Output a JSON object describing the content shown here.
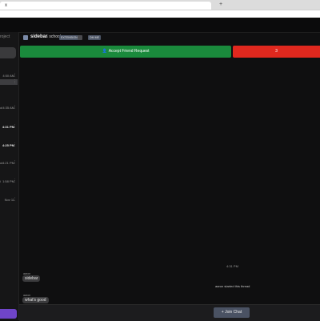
{
  "browser": {
    "tab_close": "x",
    "new_tab": "+"
  },
  "sidebar": {
    "title_fragment": "roject",
    "items": [
      {
        "time": "4:50 AM",
        "bold": false,
        "active": false,
        "fragment": false
      },
      {
        "time": "",
        "bold": false,
        "active": true,
        "fragment": false
      },
      {
        "time": "4:35 AM",
        "bold": false,
        "active": false,
        "fragment": true,
        "lead": "ol"
      },
      {
        "time": "4:31 PM",
        "bold": true,
        "active": false,
        "fragment": false
      },
      {
        "time": "4:25 PM",
        "bold": true,
        "active": false,
        "fragment": false
      },
      {
        "time": "4:21 PM",
        "bold": false,
        "active": false,
        "fragment": true,
        "lead": "ut"
      },
      {
        "time": "1:58 PM",
        "bold": false,
        "active": false,
        "fragment": true,
        "lead": "i"
      },
      {
        "time": "Nov 11",
        "bold": false,
        "active": false,
        "fragment": false
      }
    ]
  },
  "header": {
    "name": "sidebar",
    "home_label": "⌂ school",
    "tag1": "EXTENSION",
    "tag2": "DM ME"
  },
  "friend_request": {
    "accept_label": "Accept Friend Request",
    "accept_icon": "user-plus-icon",
    "decline_label": "3"
  },
  "chat": {
    "time_separator": "4:31 PM",
    "messages": [
      {
        "sender": "aaron",
        "text": "sidebar"
      },
      {
        "sender": "aaron",
        "text": "what's good"
      }
    ],
    "system_message": "aaron started this thread"
  },
  "footer": {
    "join_label": "Join Chat",
    "join_icon": "plus-icon"
  },
  "colors": {
    "accept": "#1a8a3c",
    "decline": "#e0281e",
    "purple": "#6f45c8"
  }
}
